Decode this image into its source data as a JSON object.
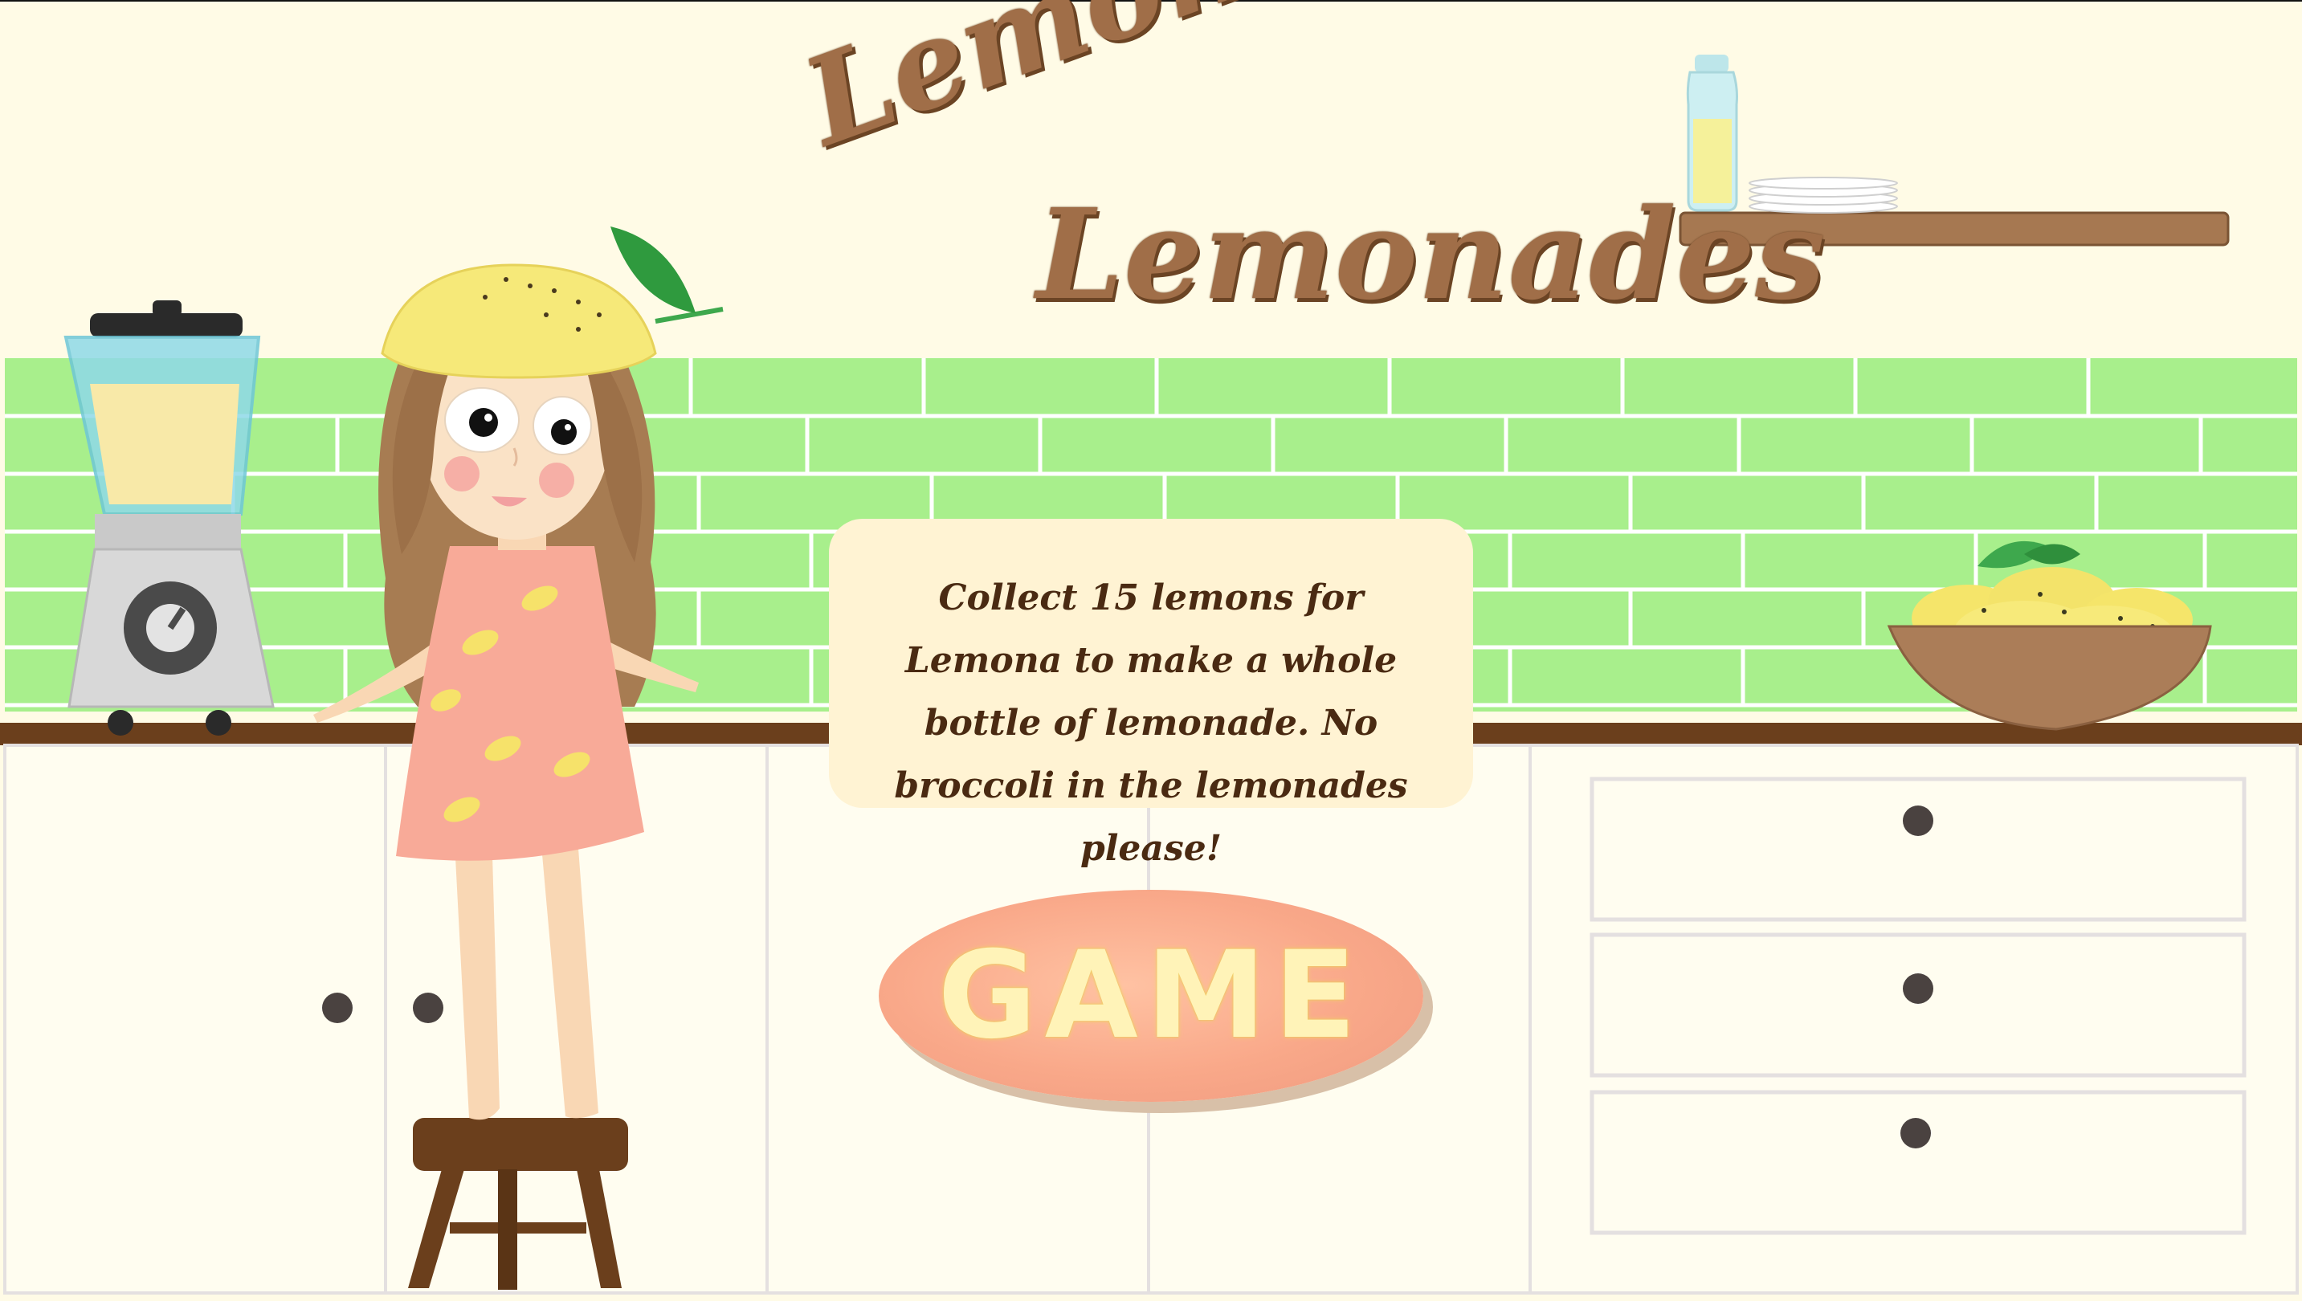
{
  "title": {
    "line1": "Lemonas",
    "line2": "Lemonades"
  },
  "instructions": {
    "text": "Collect 15 lemons for Lemona to make a whole bottle of lemonade. No broccoli in the lemonades please!"
  },
  "buttons": {
    "game_label": "GAME"
  },
  "colors": {
    "wall": "#fffbe6",
    "tiles": "#a8ef8c",
    "countertop": "#6b3f1c",
    "cabinets": "#fffdf0",
    "title_text": "#a06e48",
    "instruction_panel": "#fff3d3",
    "game_button": "#f9a889",
    "game_button_text": "#fff3b8"
  },
  "icons": {
    "character": "girl-with-lemon-hat",
    "blender": "blender-icon",
    "bowl": "lemon-bowl-icon",
    "bottle": "lemonade-bottle-icon",
    "stool": "stool-icon"
  }
}
